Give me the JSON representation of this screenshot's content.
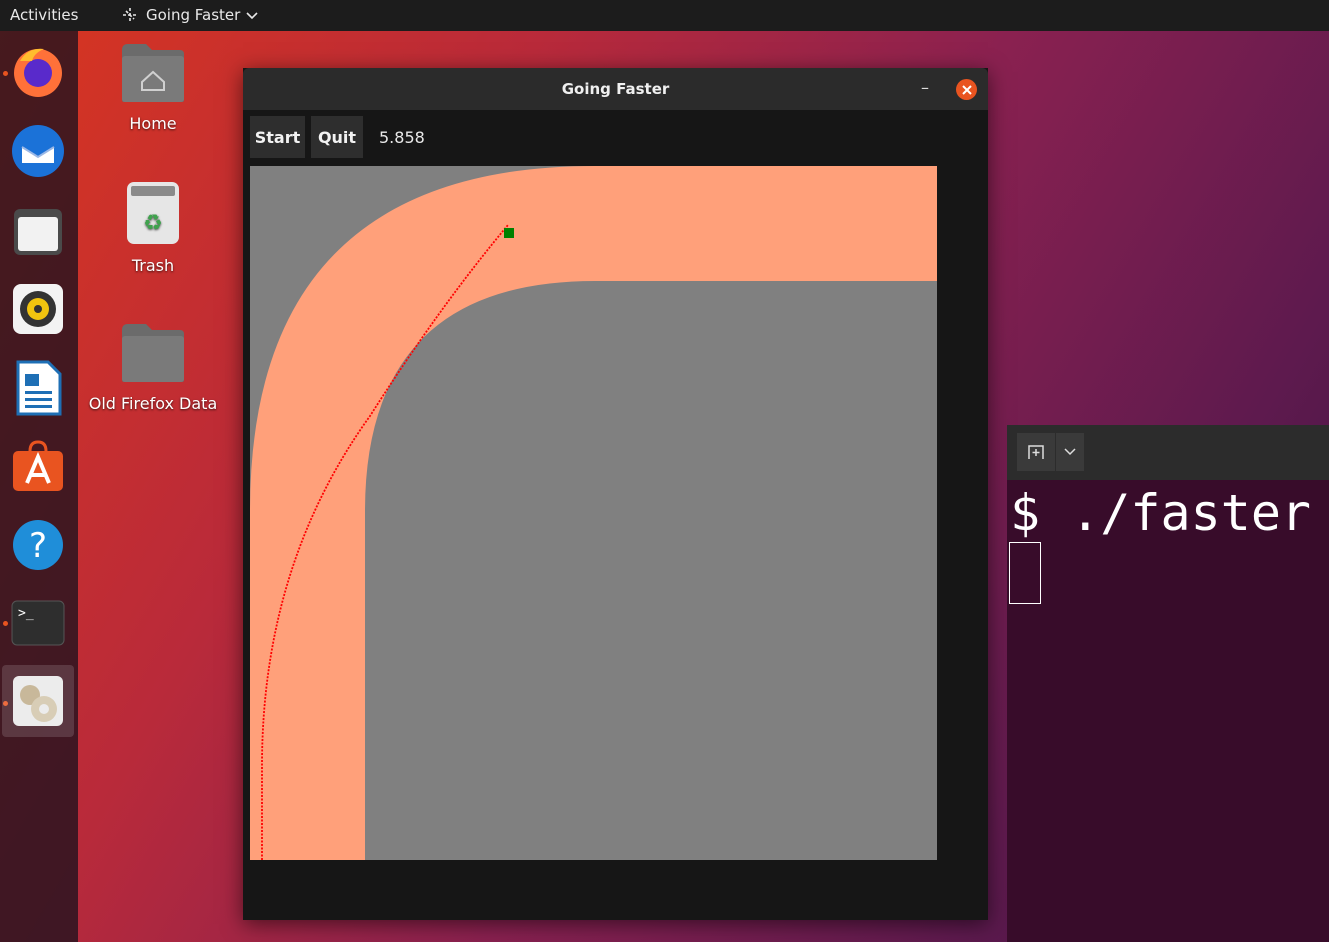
{
  "topbar": {
    "activities": "Activities",
    "app_name": "Going Faster"
  },
  "desktop": {
    "icons": [
      {
        "label": "Home"
      },
      {
        "label": "Trash"
      },
      {
        "label": "Old Firefox Data"
      }
    ]
  },
  "dock": {
    "items": [
      "firefox-icon",
      "thunderbird-icon",
      "files-icon",
      "rhythmbox-icon",
      "writer-icon",
      "software-icon",
      "help-icon",
      "terminal-icon",
      "app-icon"
    ]
  },
  "window": {
    "title": "Going Faster",
    "start_label": "Start",
    "quit_label": "Quit",
    "score": "5.858",
    "colors": {
      "track": "#ffa07a",
      "background": "#808080",
      "path": "#ff0000",
      "car": "#008000"
    }
  },
  "terminal": {
    "command_line": "$ ./faster"
  },
  "colors": {
    "accent": "#e95420"
  }
}
